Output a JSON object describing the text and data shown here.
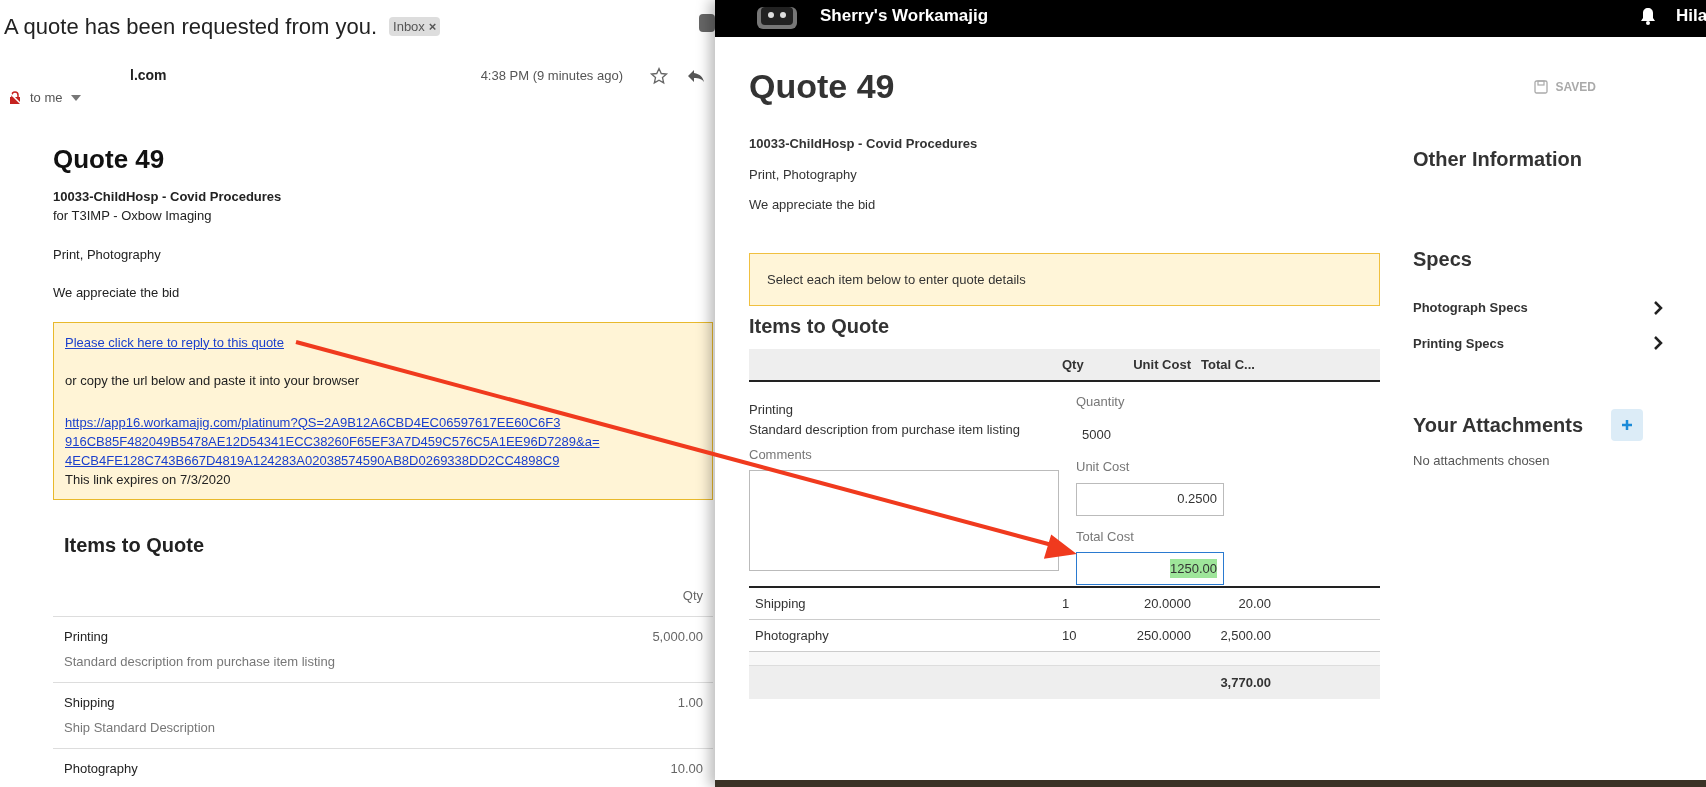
{
  "email": {
    "subject": "A quote has been requested from you.",
    "label": "Inbox",
    "label_close": "×",
    "sender": "l.com",
    "time": "4:38 PM (9 minutes ago)",
    "recipient": "to me",
    "quote_title": "Quote 49",
    "project": "10033-ChildHosp - Covid Procedures",
    "client": "for T3IMP - Oxbow Imaging",
    "services": "Print, Photography",
    "message": "We appreciate the bid",
    "notice": {
      "reply_link": "Please click here to reply to this quote",
      "copy_text": "or copy the url below and paste it into your browser",
      "url_lines": [
        "https://app16.workamajig.com/platinum?QS=2A9B12A6CBD4EC06597617EE60C6F3",
        "916CB85F482049B5478AE12D54341ECC38260F65EF3A7D459C576C5A1EE96D7289&a=",
        "4ECB4FE128C743B667D4819A124283A02038574590AB8D0269338DD2CC4898C9"
      ],
      "expiry": "This link expires on 7/3/2020"
    },
    "items_heading": "Items to Quote",
    "qty_heading": "Qty",
    "items": [
      {
        "name": "Printing",
        "description": "Standard description from purchase item listing",
        "qty": "5,000.00"
      },
      {
        "name": "Shipping",
        "description": "Ship Standard Description",
        "qty": "1.00"
      },
      {
        "name": "Photography",
        "qty": "10.00"
      }
    ]
  },
  "app": {
    "title": "Sherry's Workamajig",
    "user": "Hila",
    "quote_title": "Quote 49",
    "save_status": "SAVED",
    "project": "10033-ChildHosp - Covid Procedures",
    "services": "Print, Photography",
    "message": "We appreciate the bid",
    "notice": "Select each item below to enter quote details",
    "items_heading": "Items to Quote",
    "columns": [
      "Qty",
      "Unit Cost",
      "Total C..."
    ],
    "expanded_item": {
      "name": "Printing",
      "description": "Standard description from purchase item listing",
      "comments_label": "Comments",
      "quantity_label": "Quantity",
      "quantity": "5000",
      "unit_cost_label": "Unit Cost",
      "unit_cost": "0.2500",
      "total_cost_label": "Total Cost",
      "total_cost": "1250.00"
    },
    "rows": [
      {
        "name": "Shipping",
        "qty": "1",
        "unit_cost": "20.0000",
        "total": "20.00"
      },
      {
        "name": "Photography",
        "qty": "10",
        "unit_cost": "250.0000",
        "total": "2,500.00"
      }
    ],
    "grand_total": "3,770.00",
    "side": {
      "other_heading": "Other Information",
      "specs_heading": "Specs",
      "specs": [
        "Photograph Specs",
        "Printing Specs"
      ],
      "attachments_heading": "Your Attachments",
      "attachments_empty": "No attachments chosen"
    }
  }
}
